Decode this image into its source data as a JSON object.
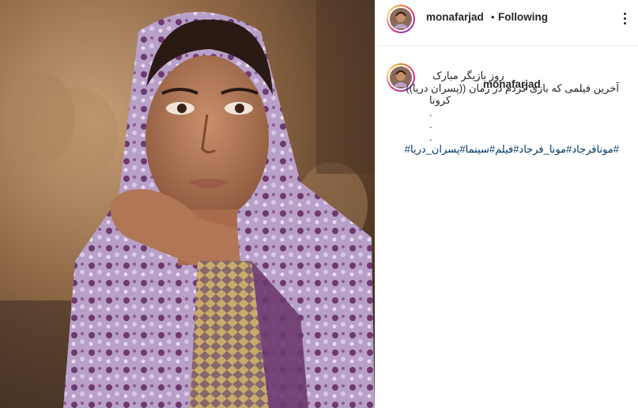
{
  "post": {
    "author": {
      "username": "monafarjad",
      "separator": "•",
      "follow_status": "Following"
    },
    "caption": {
      "username": "monafarjad",
      "lines": [
        "روز بازیگر مبارک",
        "آخرین فیلمی که بازی کردم در زمان ((پسران دریا))",
        "کرونا"
      ],
      "dots": [
        ".",
        ".",
        "."
      ],
      "hashtags": "#مونافرجاد#مونا_فرجاد#فیلم#سینما#پسران_دریا#"
    }
  },
  "icons": {
    "more_options": "more-horizontal-icon",
    "avatar": "profile-avatar"
  },
  "colors": {
    "text": "#262626",
    "hashtag": "#00376b",
    "border": "#efefef",
    "ring_start": "#f58529",
    "ring_end": "#8134af"
  }
}
